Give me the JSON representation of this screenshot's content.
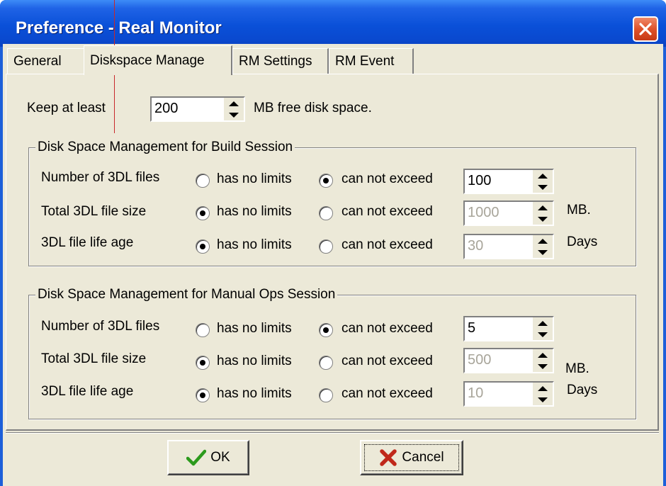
{
  "window": {
    "title": "Preference - Real Monitor"
  },
  "tabs": [
    {
      "label": "General",
      "active": false
    },
    {
      "label": "Diskspace Manage",
      "active": true
    },
    {
      "label": "RM Settings",
      "active": false
    },
    {
      "label": "RM Event",
      "active": false
    }
  ],
  "keep": {
    "prefix": "Keep at least",
    "value": "200",
    "suffix": "MB free disk space."
  },
  "build": {
    "title": "Disk Space Management for Build Session",
    "rows": [
      {
        "label": "Number of 3DL files",
        "opt1": "has no limits",
        "opt2": "can not exceed",
        "selected": "opt2",
        "value": "100",
        "enabled": true,
        "unit": ""
      },
      {
        "label": "Total 3DL file size",
        "opt1": "has no limits",
        "opt2": "can not exceed",
        "selected": "opt1",
        "value": "1000",
        "enabled": false,
        "unit": "MB."
      },
      {
        "label": "3DL file life age",
        "opt1": "has no limits",
        "opt2": "can not exceed",
        "selected": "opt1",
        "value": "30",
        "enabled": false,
        "unit": "Days"
      }
    ]
  },
  "manual": {
    "title": "Disk Space Management for Manual Ops Session",
    "rows": [
      {
        "label": "Number of 3DL files",
        "opt1": "has no limits",
        "opt2": "can not exceed",
        "selected": "opt2",
        "value": "5",
        "enabled": true,
        "unit": ""
      },
      {
        "label": "Total 3DL file size",
        "opt1": "has no limits",
        "opt2": "can not exceed",
        "selected": "opt1",
        "value": "500",
        "enabled": false,
        "unit": "MB."
      },
      {
        "label": "3DL file life age",
        "opt1": "has no limits",
        "opt2": "can not exceed",
        "selected": "opt1",
        "value": "10",
        "enabled": false,
        "unit": "Days"
      }
    ]
  },
  "buttons": {
    "ok": "OK",
    "cancel": "Cancel"
  },
  "icons": {
    "close": "close-icon",
    "ok": "checkmark-icon",
    "cancel": "x-icon"
  },
  "colors": {
    "titlebar": "#0a50d8",
    "face": "#ece9d8",
    "close": "#e0512a",
    "check": "#2c9a1c",
    "x": "#c0281a"
  }
}
